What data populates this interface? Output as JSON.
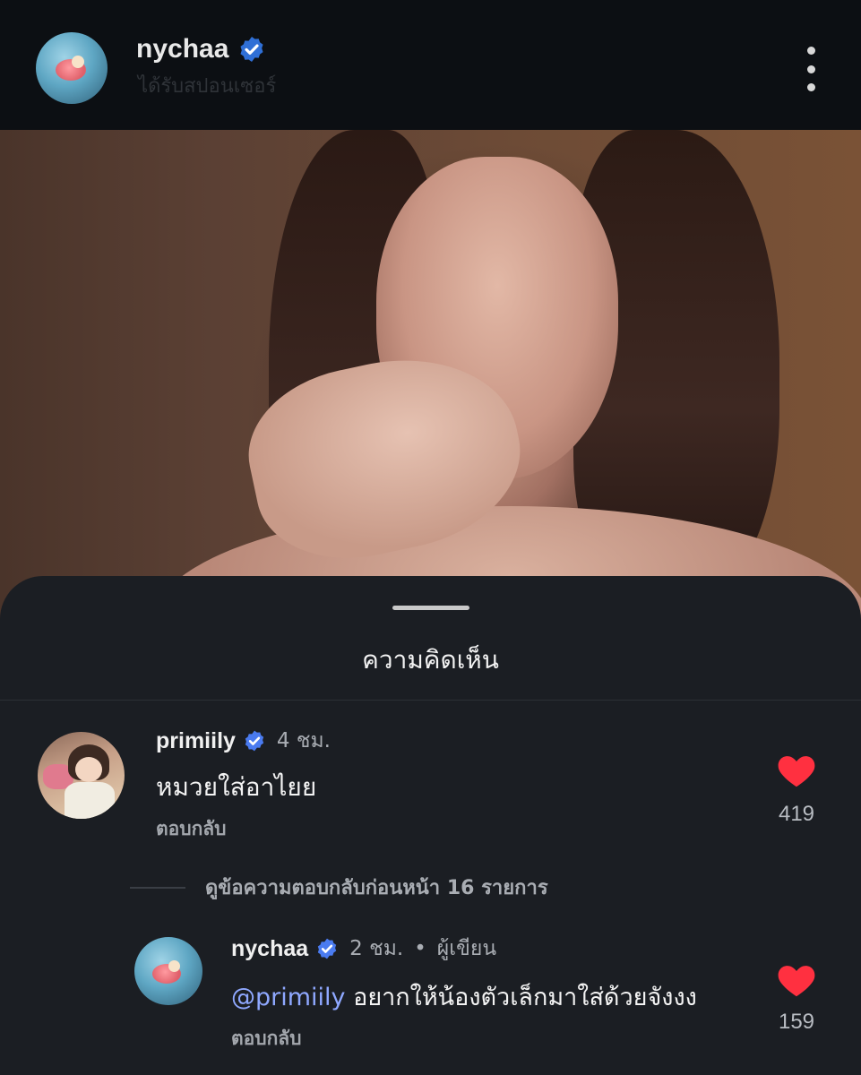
{
  "header": {
    "username": "nychaa",
    "subtitle": "ได้รับสปอนเซอร์"
  },
  "sheet": {
    "title": "ความคิดเห็น"
  },
  "comments": [
    {
      "username": "primiily",
      "time": "4 ชม.",
      "text": "หมวยใส่อาไยย",
      "reply_label": "ตอบกลับ",
      "likes": "419"
    }
  ],
  "view_replies": {
    "label": "ดูข้อความตอบกลับก่อนหน้า 16 รายการ"
  },
  "replies": [
    {
      "username": "nychaa",
      "time": "2 ชม.",
      "separator": "•",
      "author_tag": "ผู้เขียน",
      "mention": "@primiily",
      "text": " อยากให้น้องตัวเล็กมาใส่ด้วยจังงง",
      "reply_label": "ตอบกลับ",
      "likes": "159"
    }
  ],
  "colors": {
    "verified": "#2f6fd6",
    "heart": "#ff3040",
    "mention": "#8fa8ff"
  }
}
